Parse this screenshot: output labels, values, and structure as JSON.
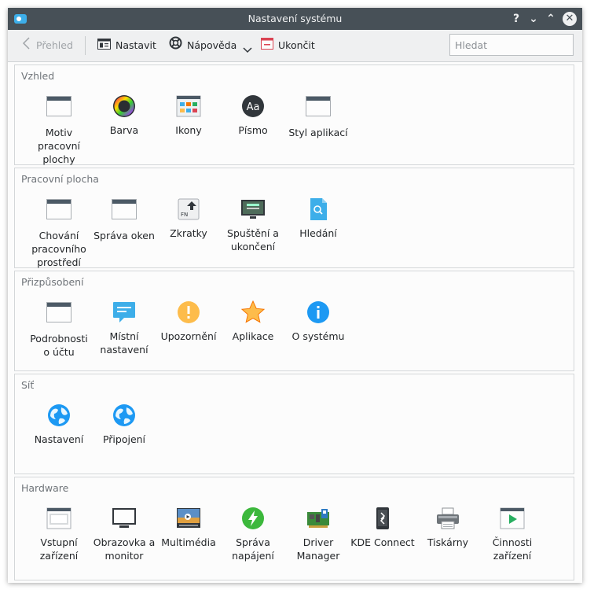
{
  "window": {
    "title": "Nastavení systému"
  },
  "titlebar": {
    "help": "?",
    "minimize": "⌄",
    "maximize": "⌃",
    "close": "✕"
  },
  "toolbar": {
    "overview": "Přehled",
    "configure": "Nastavit",
    "help": "Nápověda",
    "quit": "Ukončit",
    "search_placeholder": "Hledat"
  },
  "groups": [
    {
      "title": "Vzhled",
      "items": [
        {
          "label": "Motiv pracovní plochy",
          "icon": "desktop-theme-icon"
        },
        {
          "label": "Barva",
          "icon": "color-icon"
        },
        {
          "label": "Ikony",
          "icon": "icons-icon"
        },
        {
          "label": "Písmo",
          "icon": "font-icon"
        },
        {
          "label": "Styl aplikací",
          "icon": "app-style-icon"
        }
      ]
    },
    {
      "title": "Pracovní plocha",
      "items": [
        {
          "label": "Chování pracovního prostředí",
          "icon": "workspace-behavior-icon"
        },
        {
          "label": "Správa oken",
          "icon": "window-management-icon"
        },
        {
          "label": "Zkratky",
          "icon": "shortcuts-icon"
        },
        {
          "label": "Spuštění a ukončení",
          "icon": "startup-shutdown-icon"
        },
        {
          "label": "Hledání",
          "icon": "search-icon"
        }
      ]
    },
    {
      "title": "Přizpůsobení",
      "items": [
        {
          "label": "Podrobnosti o účtu",
          "icon": "account-icon"
        },
        {
          "label": "Místní nastavení",
          "icon": "locale-icon"
        },
        {
          "label": "Upozornění",
          "icon": "notifications-icon"
        },
        {
          "label": "Aplikace",
          "icon": "applications-icon"
        },
        {
          "label": "O systému",
          "icon": "about-icon"
        }
      ]
    },
    {
      "title": "Síť",
      "items": [
        {
          "label": "Nastavení",
          "icon": "network-settings-icon"
        },
        {
          "label": "Připojení",
          "icon": "connections-icon"
        }
      ]
    },
    {
      "title": "Hardware",
      "items": [
        {
          "label": "Vstupní zařízení",
          "icon": "input-devices-icon"
        },
        {
          "label": "Obrazovka a monitor",
          "icon": "display-icon"
        },
        {
          "label": "Multimédia",
          "icon": "multimedia-icon"
        },
        {
          "label": "Správa napájení",
          "icon": "power-icon"
        },
        {
          "label": "Driver Manager",
          "icon": "driver-manager-icon"
        },
        {
          "label": "KDE Connect",
          "icon": "kde-connect-icon"
        },
        {
          "label": "Tiskárny",
          "icon": "printer-icon"
        },
        {
          "label": "Činnosti zařízení",
          "icon": "device-actions-icon"
        }
      ]
    }
  ],
  "colors": {
    "titlebar": "#475057",
    "accent": "#3daee9",
    "toolbar": "#eff0f1"
  }
}
